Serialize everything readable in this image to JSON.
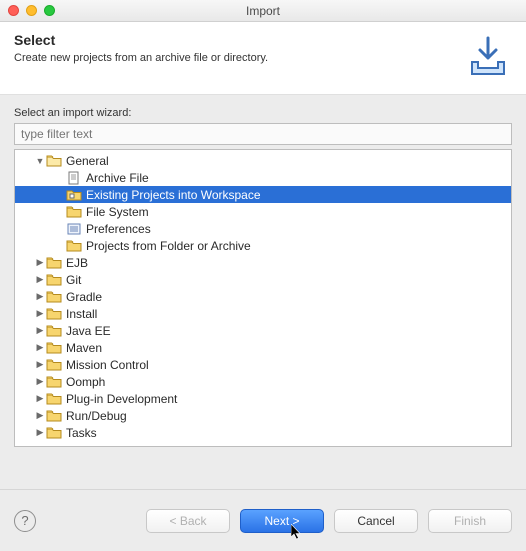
{
  "window": {
    "title": "Import"
  },
  "header": {
    "heading": "Select",
    "description": "Create new projects from an archive file or directory."
  },
  "body": {
    "label": "Select an import wizard:",
    "filter_placeholder": "type filter text"
  },
  "tree": {
    "general": {
      "label": "General",
      "children": [
        {
          "id": "archive-file",
          "label": "Archive File",
          "icon": "doc"
        },
        {
          "id": "existing-projects",
          "label": "Existing Projects into Workspace",
          "icon": "proj",
          "selected": true
        },
        {
          "id": "file-system",
          "label": "File System",
          "icon": "folder"
        },
        {
          "id": "preferences",
          "label": "Preferences",
          "icon": "prefs"
        },
        {
          "id": "projects-from-folder",
          "label": "Projects from Folder or Archive",
          "icon": "folder"
        }
      ]
    },
    "collapsed": [
      {
        "id": "ejb",
        "label": "EJB"
      },
      {
        "id": "git",
        "label": "Git"
      },
      {
        "id": "gradle",
        "label": "Gradle"
      },
      {
        "id": "install",
        "label": "Install"
      },
      {
        "id": "java-ee",
        "label": "Java EE"
      },
      {
        "id": "maven",
        "label": "Maven"
      },
      {
        "id": "mission-control",
        "label": "Mission Control"
      },
      {
        "id": "oomph",
        "label": "Oomph"
      },
      {
        "id": "plugin-dev",
        "label": "Plug-in Development"
      },
      {
        "id": "run-debug",
        "label": "Run/Debug"
      },
      {
        "id": "tasks",
        "label": "Tasks"
      }
    ]
  },
  "footer": {
    "back": "< Back",
    "next": "Next >",
    "cancel": "Cancel",
    "finish": "Finish"
  }
}
